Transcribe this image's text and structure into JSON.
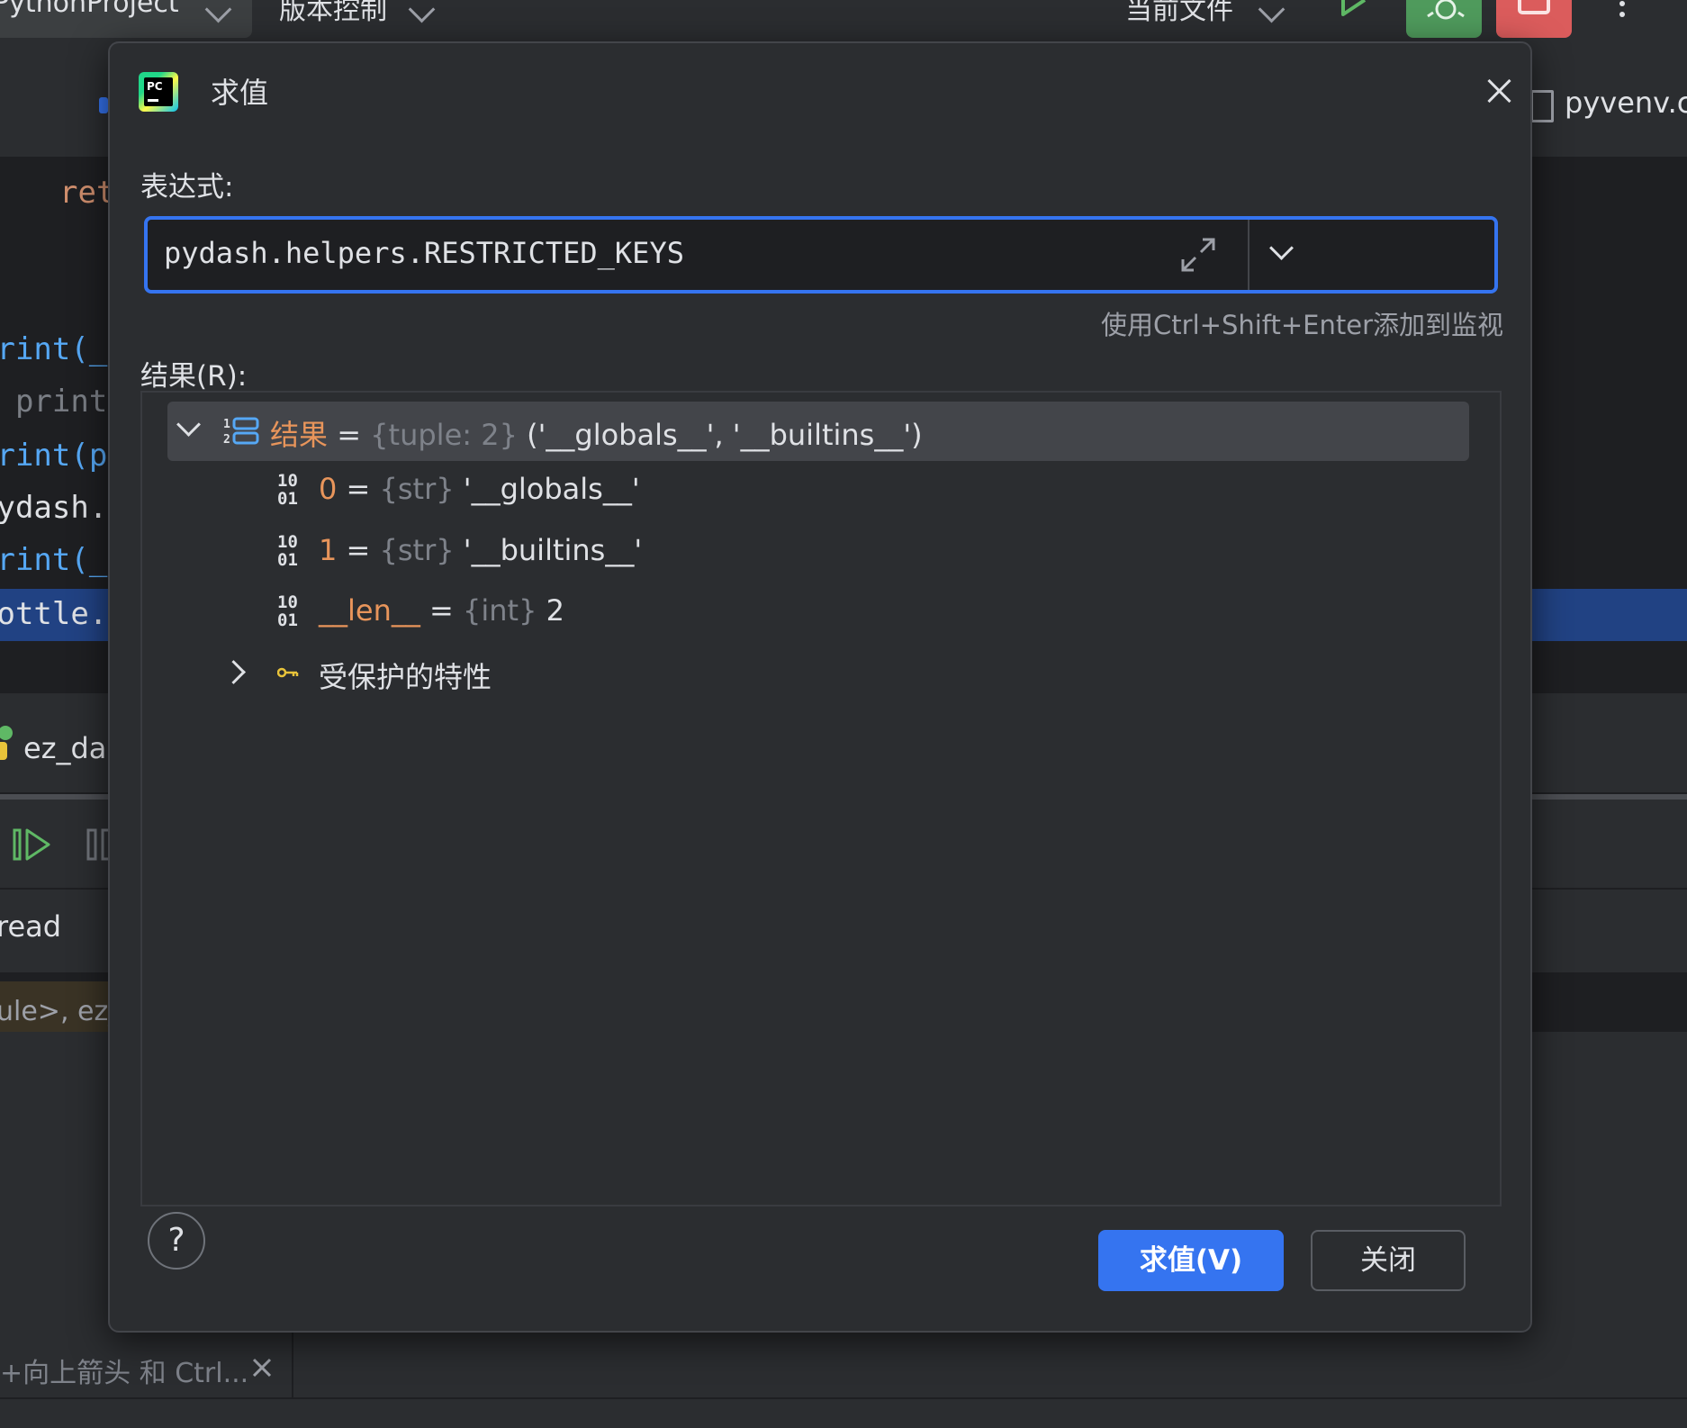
{
  "ide": {
    "project_label": "PythonProject",
    "vcs_label": "版本控制",
    "run_config_label": "当前文件",
    "tab_right_label": "pyvenv.cf",
    "colors": {
      "run": "#5fb865",
      "debug": "#4f9a5c",
      "stop": "#db5c5c"
    },
    "code_lines": [
      "ret",
      "print(_",
      "# print",
      "print(p",
      "pydash.",
      "print(_",
      "bottle."
    ],
    "run_tab_label": "ez_das",
    "thread_label": "read",
    "frame_label": "ule>, ez_",
    "bottom_hint": "+向上箭头 和 Ctrl...",
    "icons": [
      "chevron-down-icon",
      "run-icon",
      "debug-icon",
      "stop-icon",
      "more-icon",
      "file-icon",
      "resume-icon",
      "pause-icon",
      "python-icon",
      "close-icon"
    ]
  },
  "dialog": {
    "title": "求值",
    "expression_label": "表达式:",
    "expression_value": "pydash.helpers.RESTRICTED_KEYS",
    "watch_hint": "使用Ctrl+Shift+Enter添加到监视",
    "result_label": "结果(R):",
    "accent": "#3574f0",
    "result_tree": {
      "root": {
        "name": "结果",
        "eq": "=",
        "type": "{tuple: 2}",
        "value": "('__globals__', '__builtins__')"
      },
      "children": [
        {
          "name": "0",
          "eq": "=",
          "type": "{str}",
          "value": "'__globals__'"
        },
        {
          "name": "1",
          "eq": "=",
          "type": "{str}",
          "value": "'__builtins__'"
        },
        {
          "name": "__len__",
          "eq": "=",
          "type": "{int}",
          "value": "2"
        }
      ],
      "protected_label": "受保护的特性"
    },
    "help_label": "?",
    "evaluate_button": "求值(V)",
    "close_button": "关闭"
  }
}
